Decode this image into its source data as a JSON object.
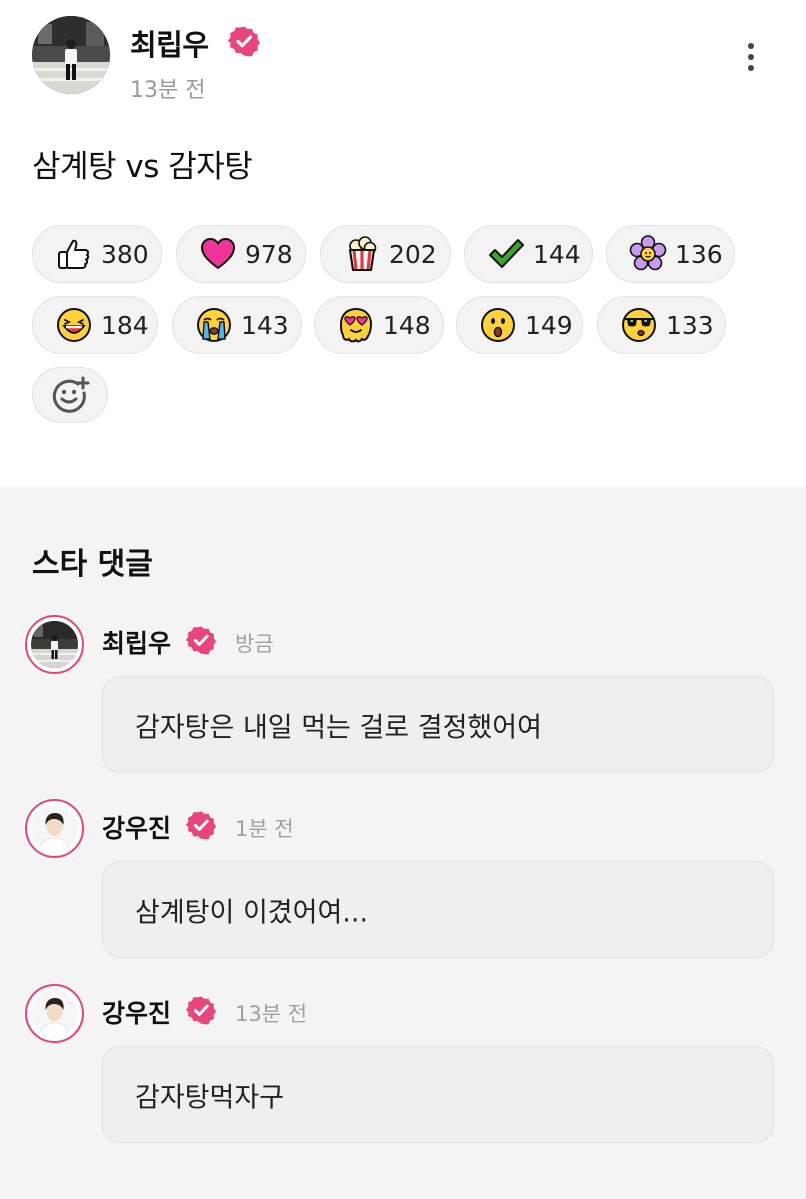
{
  "post": {
    "author": "최립우",
    "time": "13분 전",
    "text": "삼계탕 vs 감자탕",
    "more_icon": "more-vertical-icon",
    "verified_color": "#e8457a"
  },
  "reactions": [
    {
      "icon": "thumbs-up-icon",
      "count": "380"
    },
    {
      "icon": "heart-icon",
      "count": "978"
    },
    {
      "icon": "popcorn-icon",
      "count": "202"
    },
    {
      "icon": "check-icon",
      "count": "144"
    },
    {
      "icon": "flower-icon",
      "count": "136"
    },
    {
      "icon": "laughing-face-icon",
      "count": "184"
    },
    {
      "icon": "crying-face-icon",
      "count": "143"
    },
    {
      "icon": "heart-eyes-face-icon",
      "count": "148"
    },
    {
      "icon": "surprised-face-icon",
      "count": "149"
    },
    {
      "icon": "sunglasses-face-icon",
      "count": "133"
    }
  ],
  "add_reaction_icon": "add-emoji-icon",
  "comments_section": {
    "title": "스타 댓글",
    "items": [
      {
        "name": "최립우",
        "time": "방금",
        "text": "감자탕은 내일 먹는 걸로 결정했어여"
      },
      {
        "name": "강우진",
        "time": "1분 전",
        "text": "삼계탕이 이겼어여..."
      },
      {
        "name": "강우진",
        "time": "13분 전",
        "text": "감자탕먹자구"
      }
    ]
  }
}
